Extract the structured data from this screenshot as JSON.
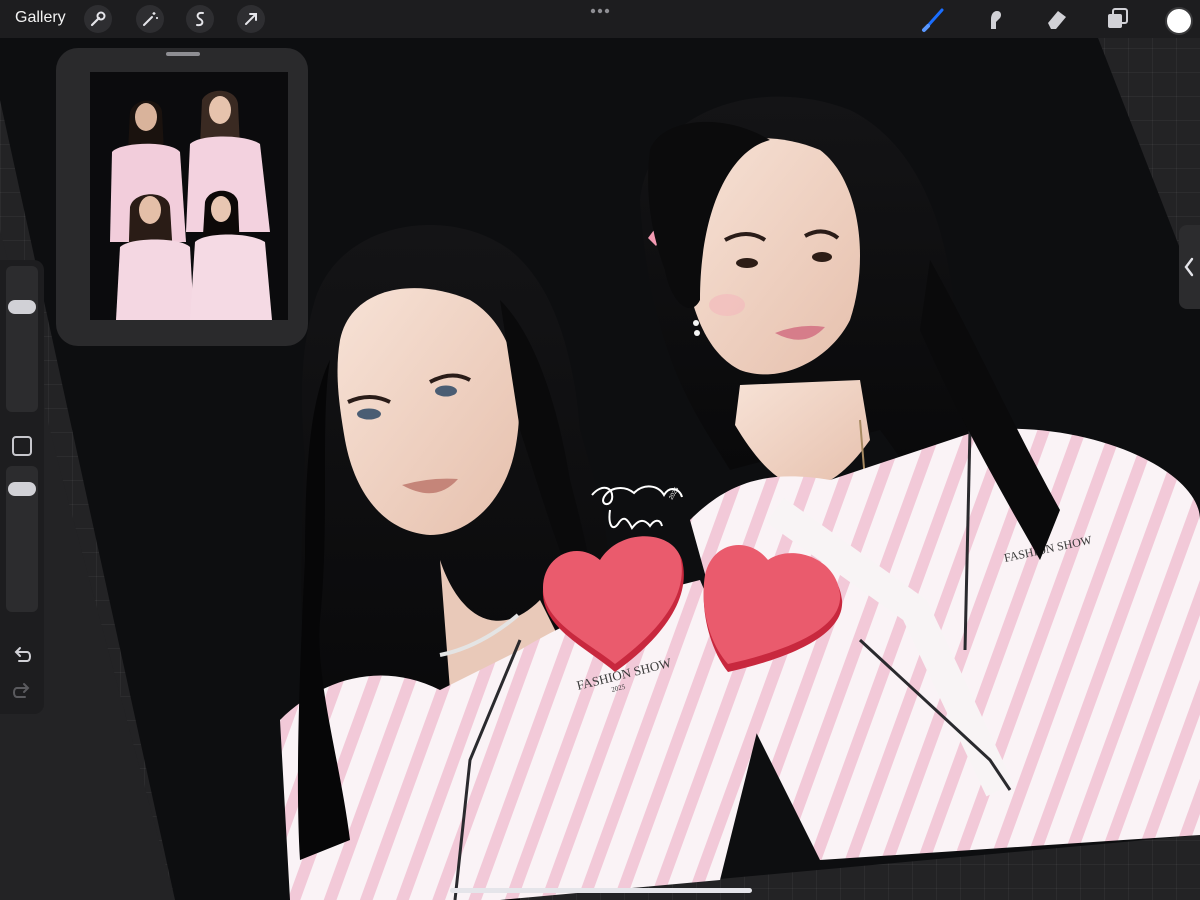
{
  "toolbar": {
    "gallery_label": "Gallery",
    "left_tools": [
      "wrench-icon",
      "magic-wand-icon",
      "selection-icon",
      "transform-arrow-icon"
    ],
    "right_tools": [
      "brush-icon",
      "smudge-icon",
      "eraser-icon",
      "layers-icon"
    ],
    "active_tool": "brush-icon",
    "accent_color": "#1a6eff",
    "current_color": "#ffffff"
  },
  "sidebar": {
    "brush_size_level": 0.1,
    "opacity_level": 0.1,
    "controls": [
      "brush-size-slider",
      "modify-button",
      "opacity-slider",
      "undo-icon",
      "redo-icon"
    ]
  },
  "artwork": {
    "signature": "amorimori julie 2025",
    "robe_text_left": "FASHION SHOW",
    "robe_year_left": "2025",
    "robe_text_right": "FASHION SHOW",
    "sticker": "two pink heart stickers"
  }
}
